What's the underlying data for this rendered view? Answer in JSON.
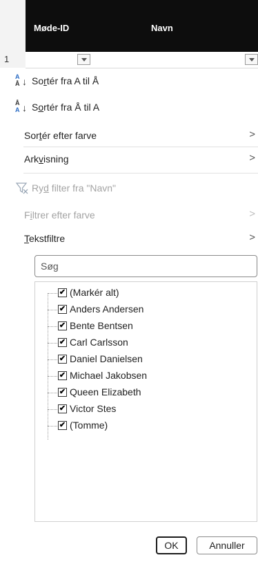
{
  "sheet": {
    "row_number": "1",
    "columns": [
      {
        "title": "Møde-ID"
      },
      {
        "title": "Navn"
      }
    ]
  },
  "menu": {
    "sort_asc": {
      "prefix": "So",
      "underlined": "r",
      "suffix": "tér fra A til Å",
      "icon_top": "A",
      "icon_bottom": "Å"
    },
    "sort_desc": {
      "prefix": "S",
      "underlined": "o",
      "suffix": "rtér fra Å til A",
      "icon_top": "Å",
      "icon_bottom": "A"
    },
    "sort_by_color": {
      "prefix": "Sor",
      "underlined": "t",
      "suffix": "ér efter farve"
    },
    "sheet_view": {
      "prefix": "Ark",
      "underlined": "v",
      "suffix": "isning"
    },
    "clear_filter": {
      "prefix": "Ry",
      "underlined": "d",
      "suffix": " filter fra \"Navn\""
    },
    "filter_by_color": {
      "prefix": "F",
      "underlined": "i",
      "suffix": "ltrer efter farve"
    },
    "text_filters": {
      "prefix": "",
      "underlined": "T",
      "suffix": "ekstfiltre"
    },
    "chevron": ">"
  },
  "search": {
    "placeholder": "Søg",
    "value": ""
  },
  "checklist": [
    {
      "label": "(Markér alt)",
      "checked": true
    },
    {
      "label": "Anders Andersen",
      "checked": true
    },
    {
      "label": "Bente Bentsen",
      "checked": true
    },
    {
      "label": "Carl Carlsson",
      "checked": true
    },
    {
      "label": "Daniel Danielsen",
      "checked": true
    },
    {
      "label": "Michael Jakobsen",
      "checked": true
    },
    {
      "label": "Queen Elizabeth",
      "checked": true
    },
    {
      "label": "Victor Stes",
      "checked": true
    },
    {
      "label": "(Tomme)",
      "checked": true
    }
  ],
  "check_mark": "✔",
  "buttons": {
    "ok": "OK",
    "cancel": "Annuller"
  },
  "colors": {
    "header_band": "#0d0d0d",
    "sort_icon_blue": "#2b6cc4",
    "disabled_text": "#a3a3a3"
  }
}
